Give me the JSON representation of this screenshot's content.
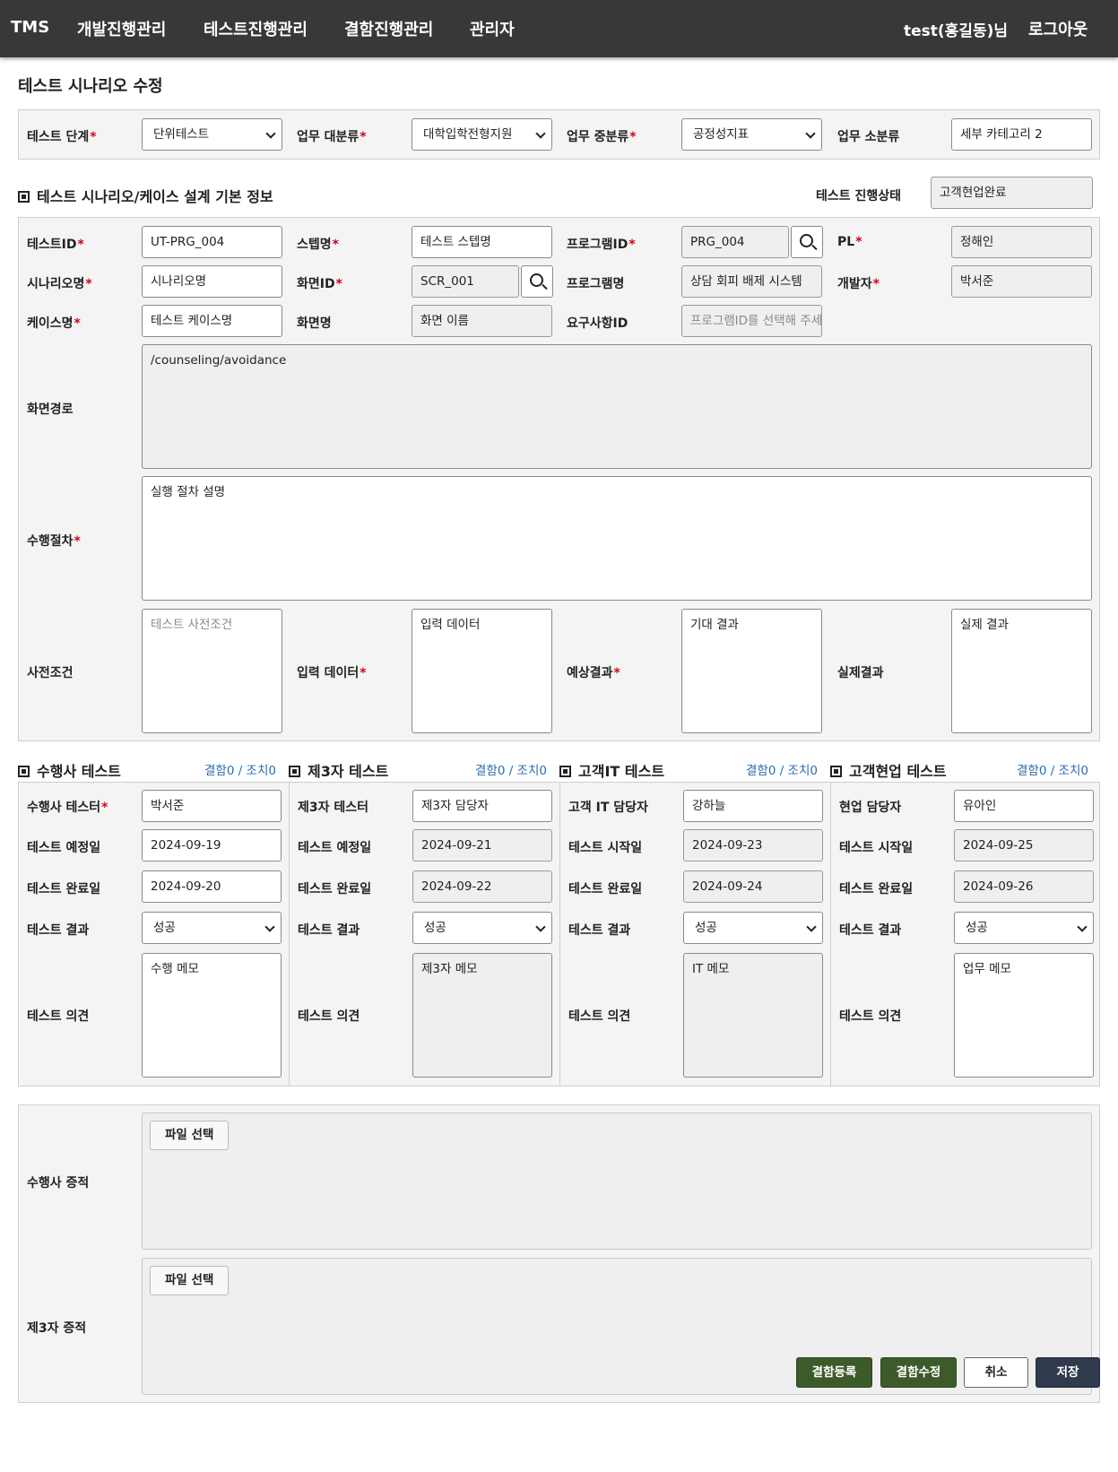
{
  "nav": {
    "brand": "TMS",
    "menus": [
      "개발진행관리",
      "테스트진행관리",
      "결함진행관리",
      "관리자"
    ],
    "user": "test(홍길동)님",
    "logout": "로그아웃"
  },
  "page_title": "테스트 시나리오 수정",
  "filters": {
    "test_stage_label": "테스트 단계",
    "test_stage_value": "단위테스트",
    "biz_major_label": "업무 대분류",
    "biz_major_value": "대학입학전형지원",
    "biz_mid_label": "업무 중분류",
    "biz_mid_value": "공정성지표",
    "biz_minor_label": "업무 소분류",
    "biz_minor_value": "세부 카테고리 2"
  },
  "basic": {
    "section_title": "테스트 시나리오/케이스 설계 기본 정보",
    "status_label": "테스트 진행상태",
    "status_value": "고객현업완료",
    "test_id_label": "테스트ID",
    "test_id_value": "UT-PRG_004",
    "step_label": "스텝명",
    "step_value": "테스트 스텝명",
    "program_id_label": "프로그램ID",
    "program_id_value": "PRG_004",
    "pl_label": "PL",
    "pl_value": "정해인",
    "scenario_label": "시나리오명",
    "scenario_value": "시나리오명",
    "screen_id_label": "화면ID",
    "screen_id_value": "SCR_001",
    "program_name_label": "프로그램명",
    "program_name_value": "상담 회피 배제 시스템",
    "developer_label": "개발자",
    "developer_value": "박서준",
    "case_label": "케이스명",
    "case_value": "테스트 케이스명",
    "screen_name_label": "화면명",
    "screen_name_value": "화면 이름",
    "req_id_label": "요구사항ID",
    "req_id_placeholder": "프로그램ID를 선택해 주세요",
    "screen_path_label": "화면경로",
    "screen_path_value": "/counseling/avoidance",
    "procedure_label": "수행절차",
    "procedure_value": "실행 절차 설명",
    "precondition_label": "사전조건",
    "precondition_placeholder": "테스트 사전조건",
    "input_label": "입력 데이터",
    "input_value": "입력 데이터",
    "expected_label": "예상결과",
    "expected_value": "기대 결과",
    "actual_label": "실제결과",
    "actual_value": "실제 결과"
  },
  "tests": [
    {
      "title": "수행사 테스트",
      "defects": "결함0 / 조치0",
      "person_label": "수행사 테스터",
      "person_required": true,
      "person_value": "박서준",
      "date1_label": "테스트 예정일",
      "date1_value": "2024-09-19",
      "date2_label": "테스트 완료일",
      "date2_value": "2024-09-20",
      "result_label": "테스트 결과",
      "result_value": "성공",
      "opinion_label": "테스트 의견",
      "opinion_value": "수행 메모"
    },
    {
      "title": "제3자 테스트",
      "defects": "결함0 / 조치0",
      "person_label": "제3자 테스터",
      "person_required": false,
      "person_value": "제3자 담당자",
      "date1_label": "테스트 예정일",
      "date1_value": "2024-09-21",
      "date2_label": "테스트 완료일",
      "date2_value": "2024-09-22",
      "result_label": "테스트 결과",
      "result_value": "성공",
      "opinion_label": "테스트 의견",
      "opinion_value": "제3자 메모"
    },
    {
      "title": "고객IT 테스트",
      "defects": "결함0 / 조치0",
      "person_label": "고객 IT 담당자",
      "person_required": false,
      "person_value": "강하늘",
      "date1_label": "테스트 시작일",
      "date1_value": "2024-09-23",
      "date2_label": "테스트 완료일",
      "date2_value": "2024-09-24",
      "result_label": "테스트 결과",
      "result_value": "성공",
      "opinion_label": "테스트 의견",
      "opinion_value": "IT 메모"
    },
    {
      "title": "고객현업 테스트",
      "defects": "결함0 / 조치0",
      "person_label": "현업 담당자",
      "person_required": false,
      "person_value": "유아인",
      "date1_label": "테스트 시작일",
      "date1_value": "2024-09-25",
      "date2_label": "테스트 완료일",
      "date2_value": "2024-09-26",
      "result_label": "테스트 결과",
      "result_value": "성공",
      "opinion_label": "테스트 의견",
      "opinion_value": "업무 메모"
    }
  ],
  "evidence": {
    "vendor_label": "수행사 증적",
    "third_label": "제3자 증적",
    "file_button": "파일 선택"
  },
  "buttons": {
    "defect_register": "결함등록",
    "defect_edit": "결함수정",
    "cancel": "취소",
    "save": "저장"
  },
  "colors": {
    "nav_bg": "#383838",
    "required": "#d0021b",
    "link": "#2b6cb0",
    "btn_green": "#3d5a2a",
    "btn_navy": "#2f3a4d"
  }
}
